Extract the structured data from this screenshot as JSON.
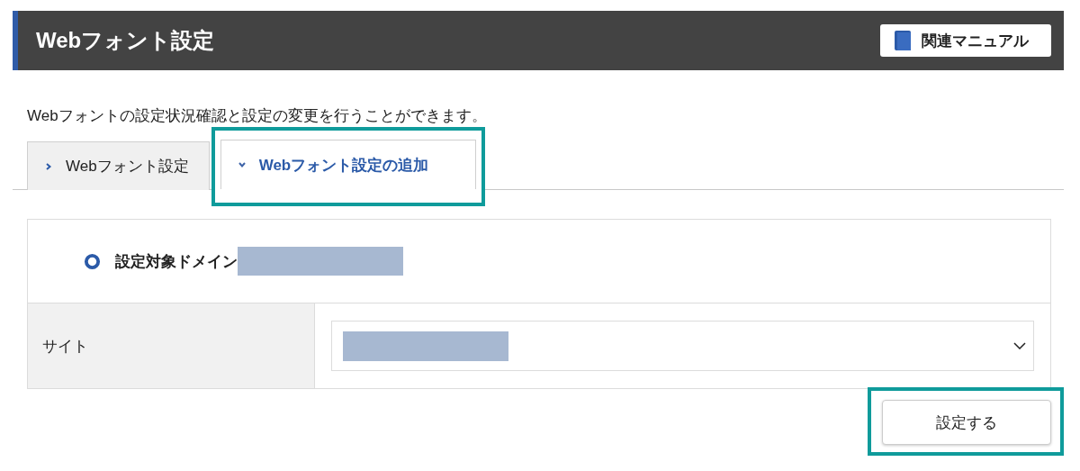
{
  "header": {
    "title": "Webフォント設定",
    "manual_button": "関連マニュアル"
  },
  "description": "Webフォントの設定状況確認と設定の変更を行うことができます。",
  "tabs": [
    {
      "label": "Webフォント設定",
      "selected": false,
      "highlighted": false
    },
    {
      "label": "Webフォント設定の追加",
      "selected": true,
      "highlighted": true
    }
  ],
  "form": {
    "heading": "設定対象ドメイン",
    "heading_redacted": true,
    "rows": [
      {
        "label": "サイト",
        "kind": "select",
        "value_redacted": true
      }
    ]
  },
  "submit": {
    "label": "設定する",
    "highlighted": true
  }
}
